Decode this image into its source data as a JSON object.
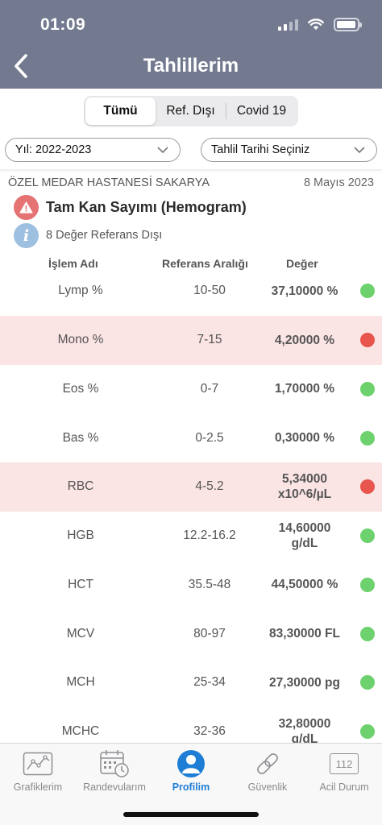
{
  "status_bar": {
    "time": "01:09"
  },
  "header": {
    "title": "Tahlillerim",
    "back_icon": "chevron-left-icon"
  },
  "segments": [
    {
      "label": "Tümü",
      "active": true
    },
    {
      "label": "Ref. Dışı",
      "active": false
    },
    {
      "label": "Covid 19",
      "active": false
    }
  ],
  "filters": {
    "year": "Yıl: 2022-2023",
    "date": "Tahlil Tarihi Seçiniz"
  },
  "result": {
    "hospital": "ÖZEL MEDAR HASTANESİ SAKARYA",
    "date": "8 Mayıs 2023",
    "test_name": "Tam Kan Sayımı (Hemogram)",
    "ref_out_text": "8 Değer Referans Dışı",
    "info_icon_glyph": "i"
  },
  "table": {
    "headers": {
      "name": "İşlem Adı",
      "range": "Referans Aralığı",
      "value": "Değer"
    },
    "rows": [
      {
        "name": "Lymp %",
        "range": "10-50",
        "value": "37,10000 %",
        "status": "normal"
      },
      {
        "name": "Mono %",
        "range": "7-15",
        "value": "4,20000 %",
        "status": "out"
      },
      {
        "name": "Eos %",
        "range": "0-7",
        "value": "1,70000 %",
        "status": "normal"
      },
      {
        "name": "Bas %",
        "range": "0-2.5",
        "value": "0,30000 %",
        "status": "normal"
      },
      {
        "name": "RBC",
        "range": "4-5.2",
        "value": "5,34000\nx10^6/µL",
        "status": "out"
      },
      {
        "name": "HGB",
        "range": "12.2-16.2",
        "value": "14,60000\ng/dL",
        "status": "normal"
      },
      {
        "name": "HCT",
        "range": "35.5-48",
        "value": "44,50000 %",
        "status": "normal"
      },
      {
        "name": "MCV",
        "range": "80-97",
        "value": "83,30000 FL",
        "status": "normal"
      },
      {
        "name": "MCH",
        "range": "25-34",
        "value": "27,30000 pg",
        "status": "normal"
      },
      {
        "name": "MCHC",
        "range": "32-36",
        "value": "32,80000\ng/dL",
        "status": "normal"
      }
    ]
  },
  "colors": {
    "header_bg": "#737a90",
    "normal": "#6dd16d",
    "out": "#e8554e",
    "out_row_bg": "#fbe4e4",
    "accent": "#1e7ed6"
  },
  "tabbar": [
    {
      "label": "Grafiklerim",
      "icon": "chart-icon",
      "active": false
    },
    {
      "label": "Randevularım",
      "icon": "calendar-clock-icon",
      "active": false
    },
    {
      "label": "Profilim",
      "icon": "user-icon",
      "active": true
    },
    {
      "label": "Güvenlik",
      "icon": "link-icon",
      "active": false
    },
    {
      "label": "Acil Durum",
      "icon": "phone-112-icon",
      "icon_text": "112",
      "active": false
    }
  ]
}
